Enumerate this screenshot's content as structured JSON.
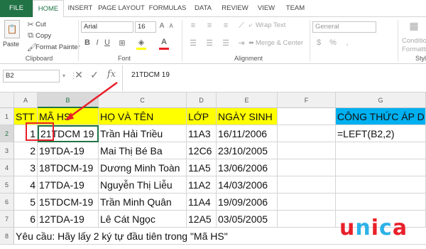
{
  "tabs": [
    "FILE",
    "HOME",
    "INSERT",
    "PAGE LAYOUT",
    "FORMULAS",
    "DATA",
    "REVIEW",
    "VIEW",
    "TEAM"
  ],
  "ribbon": {
    "cut": "Cut",
    "copy": "Copy",
    "format_painter": "Format Painter",
    "clipboard": "Clipboard",
    "paste": "Paste",
    "font_name": "Arial",
    "font_size": "16",
    "font_group": "Font",
    "wrap_text": "Wrap Text",
    "merge_center": "Merge & Center",
    "alignment": "Alignment",
    "number_format": "General",
    "conditional": "Conditional",
    "formatting": "Formatting",
    "styles": "Style"
  },
  "formula_bar": {
    "name_box": "B2",
    "formula": "21TDCM 19"
  },
  "columns": [
    "A",
    "B",
    "C",
    "D",
    "E",
    "F",
    "G"
  ],
  "rows": [
    "1",
    "2",
    "3",
    "4",
    "5",
    "6",
    "7",
    "8"
  ],
  "headers": {
    "stt": "STT",
    "ma_hs": "MÃ HS",
    "ho_ten": "HỌ VÀ TÊN",
    "lop": "LỚP",
    "ngay_sinh": "NGÀY SINH",
    "cong_thuc": "CÔNG THỨC ÁP D"
  },
  "table": [
    {
      "stt": "1",
      "ma": "21TDCM 19",
      "ten": "Trần Hải Triều",
      "lop": "11A3",
      "ngay": "16/11/2006",
      "g": "=LEFT(B2,2)"
    },
    {
      "stt": "2",
      "ma": "19TDA-19",
      "ten": "Mai Thị Bé Ba",
      "lop": "12C6",
      "ngay": "23/10/2005",
      "g": ""
    },
    {
      "stt": "3",
      "ma": "18TDCM-19",
      "ten": "Dương Minh Toàn",
      "lop": "11A5",
      "ngay": "13/06/2006",
      "g": ""
    },
    {
      "stt": "4",
      "ma": "17TDA-19",
      "ten": "Nguyễn Thị Liễu",
      "lop": "11A2",
      "ngay": "14/03/2006",
      "g": ""
    },
    {
      "stt": "5",
      "ma": "15TDCM-19",
      "ten": "Trần Minh Quân",
      "lop": "11A4",
      "ngay": "19/09/2006",
      "g": ""
    },
    {
      "stt": "6",
      "ma": "12TDA-19",
      "ten": "Lê Cát Ngọc",
      "lop": "12A5",
      "ngay": "03/05/2005",
      "g": ""
    }
  ],
  "note": "Yêu cầu: Hãy lấy 2 ký tự đầu tiên trong \"Mã HS\"",
  "logo": "unica",
  "colors": {
    "excel_green": "#217346",
    "header_yellow": "#ffff00",
    "header_blue": "#00b0f0",
    "annotation_red": "#e8202a",
    "logo_red": "#e8202a",
    "logo_blue": "#2db2e8"
  }
}
